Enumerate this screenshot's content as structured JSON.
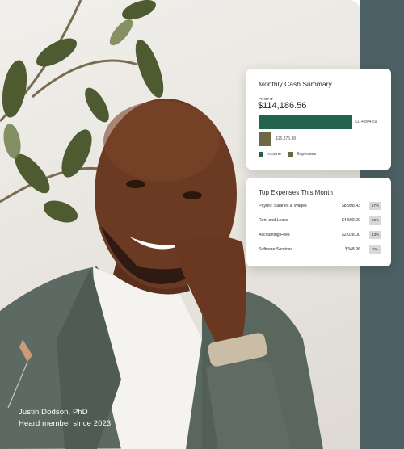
{
  "photo": {
    "caption_name": "Justin Dodson, PhD",
    "caption_member": "Heard member since 2023"
  },
  "cash_summary": {
    "title": "Monthly Cash Summary",
    "profit_label": "PROFIT",
    "profit_value": "$114,186.56",
    "income_value": "$114,804.59",
    "expenses_value": "$15,875.38",
    "income_ratio": 1.0,
    "expenses_ratio": 0.138,
    "legend_income": "Income",
    "legend_expenses": "Expenses",
    "colors": {
      "income": "#23634b",
      "expenses": "#6d6a43"
    }
  },
  "top_expenses": {
    "title": "Top Expenses This Month",
    "rows": [
      {
        "name": "Payroll: Salaries & Wages",
        "amount": "$8,998.43",
        "pct": "57%"
      },
      {
        "name": "Rent and Lease",
        "amount": "$4,500.00",
        "pct": "28%"
      },
      {
        "name": "Accounting Fees",
        "amount": "$2,028.00",
        "pct": "13%"
      },
      {
        "name": "Software Services",
        "amount": "$348.96",
        "pct": "2%"
      }
    ]
  }
}
